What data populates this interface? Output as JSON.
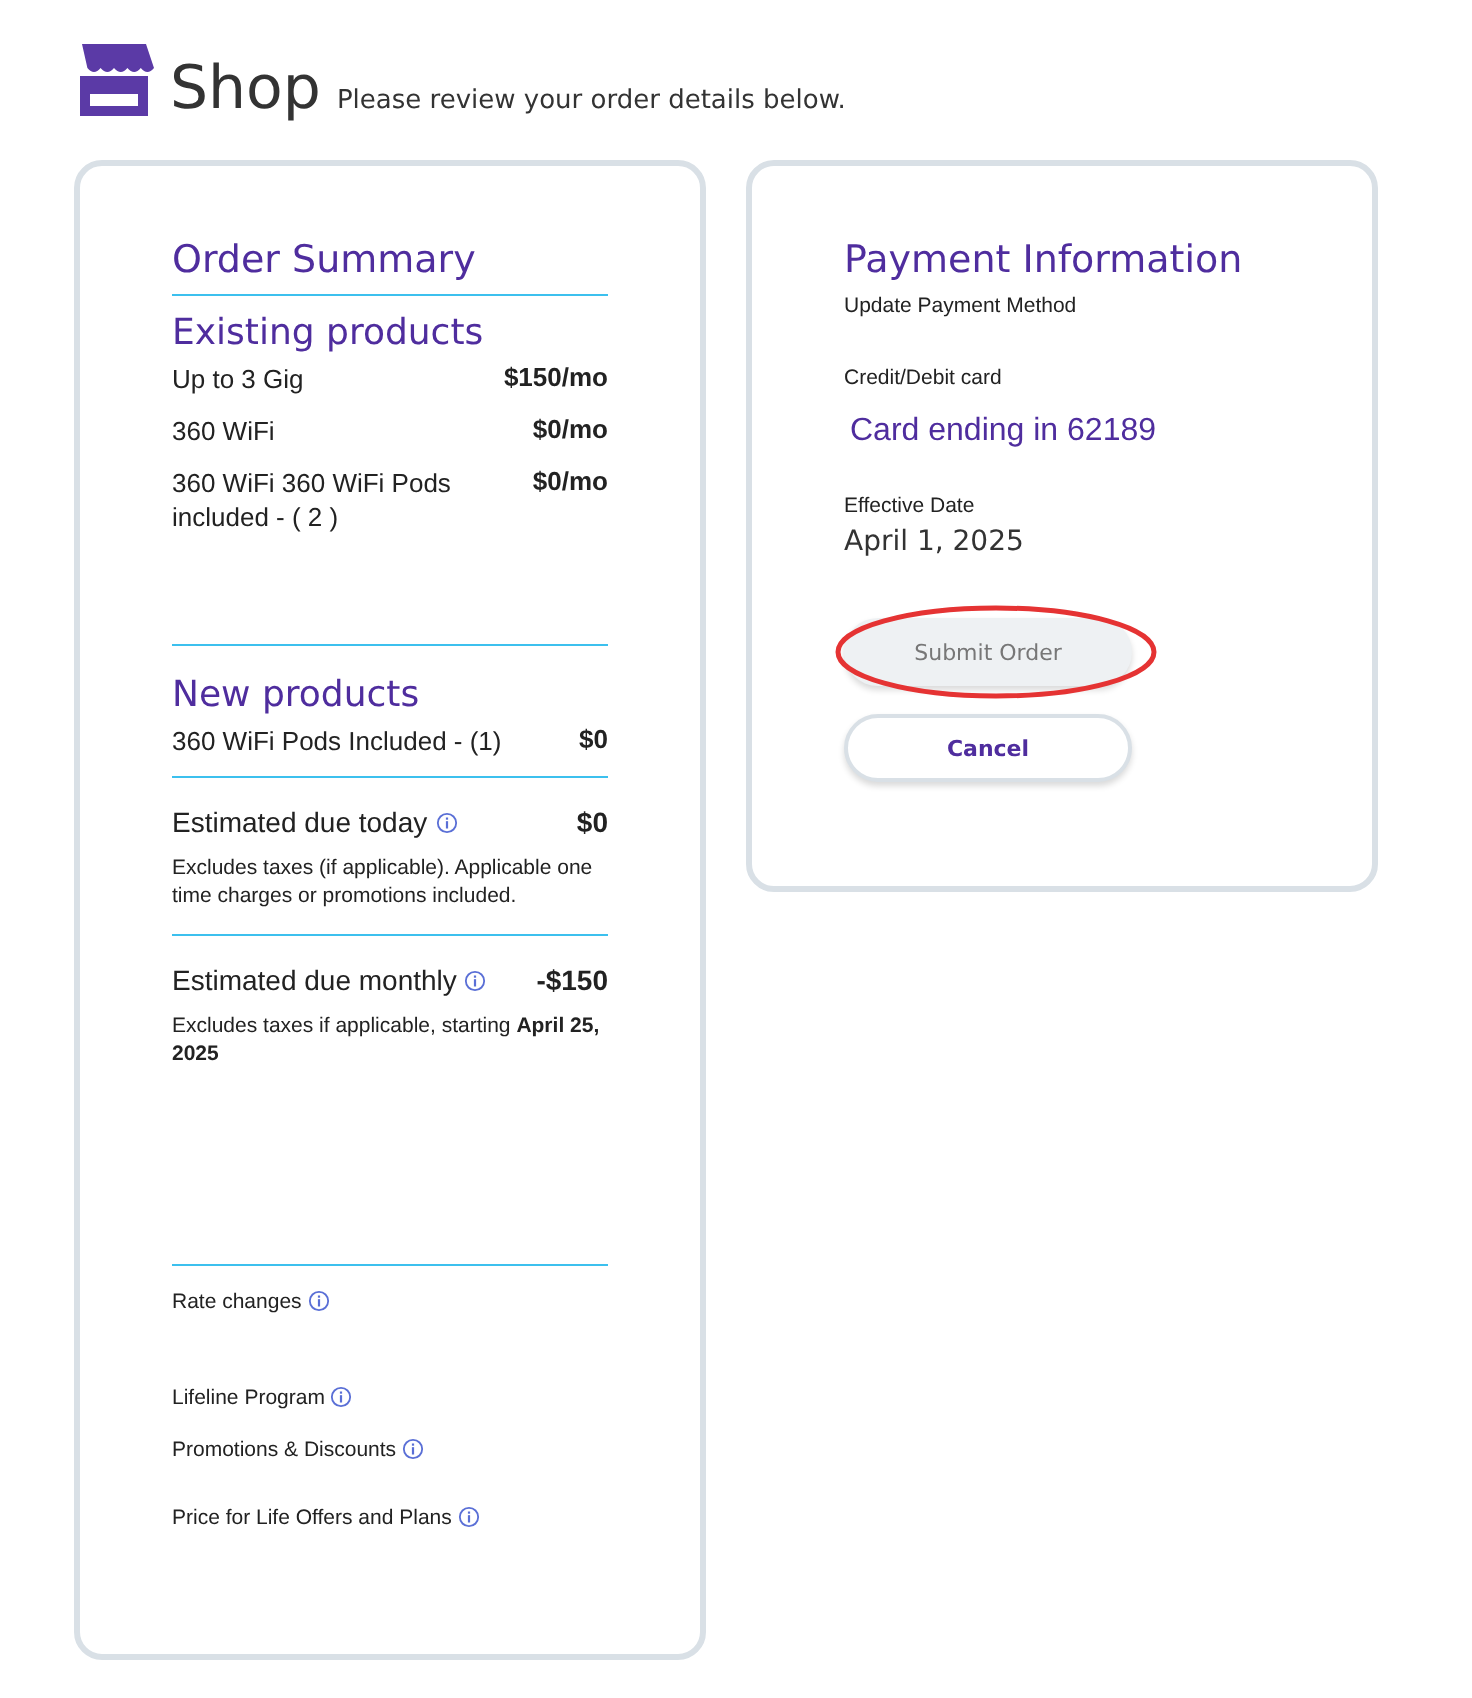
{
  "header": {
    "title": "Shop",
    "subtitle": "Please review your order details below."
  },
  "order_summary": {
    "title": "Order Summary",
    "existing": {
      "title": "Existing products",
      "items": [
        {
          "name": "Up to 3 Gig",
          "price": "$150/mo"
        },
        {
          "name": "360 WiFi",
          "price": "$0/mo"
        },
        {
          "name": "360 WiFi 360 WiFi Pods included - ( 2 )",
          "price": "$0/mo"
        }
      ]
    },
    "new": {
      "title": "New products",
      "items": [
        {
          "name": "360 WiFi Pods Included - (1)",
          "price": "$0"
        }
      ]
    },
    "due_today": {
      "label": "Estimated due today",
      "amount": "$0",
      "note": "Excludes taxes (if applicable). Applicable one time charges or promotions included."
    },
    "due_monthly": {
      "label": "Estimated due monthly",
      "amount": "-$150",
      "note": "Excludes taxes if applicable, starting **April 25, 2025**"
    },
    "links": [
      {
        "label": "Rate changes"
      },
      {
        "label": "Lifeline Program"
      },
      {
        "label": "Promotions & Discounts"
      },
      {
        "label": "Price for Life Offers and Plans"
      }
    ]
  },
  "payment": {
    "title": "Payment Information",
    "update_link": "Update Payment Method",
    "card_label": "Credit/Debit card",
    "card": "Card ending in 62189",
    "date_label": "Effective Date",
    "date": "April 1, 2025",
    "buttons": [
      {
        "kind": "submit",
        "label": "Submit Order",
        "disabled": true,
        "highlighted": true
      },
      {
        "kind": "cancel",
        "label": "Cancel",
        "disabled": false,
        "highlighted": false
      }
    ]
  }
}
